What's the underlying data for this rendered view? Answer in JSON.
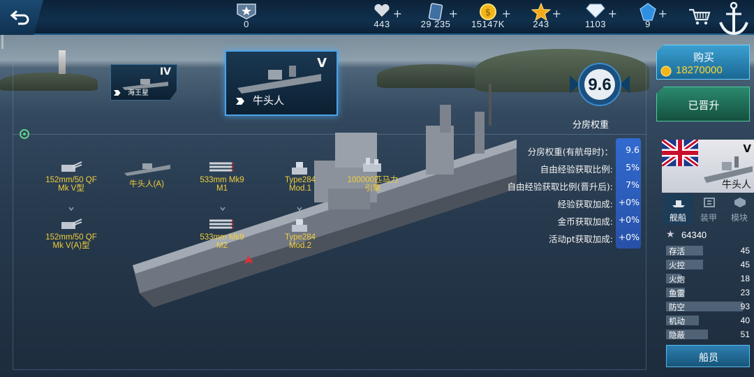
{
  "topbar": {
    "rank": {
      "icon": "rank-insignia-icon",
      "value": "0"
    },
    "resources": [
      {
        "name": "heart",
        "icon": "heart-icon",
        "value": "443"
      },
      {
        "name": "cards",
        "icon": "card-icon",
        "value": "29 235"
      },
      {
        "name": "gold",
        "icon": "gold-coin-icon",
        "value": "15147K"
      },
      {
        "name": "star",
        "icon": "star-icon",
        "value": "243"
      },
      {
        "name": "diamond",
        "icon": "diamond-icon",
        "value": "1103"
      },
      {
        "name": "gem",
        "icon": "blue-gem-icon",
        "value": "9"
      }
    ],
    "plus": "+"
  },
  "ship_cards": {
    "small": {
      "tier": "IV",
      "name": "海王星"
    },
    "selected": {
      "tier": "V",
      "name": "牛头人"
    }
  },
  "score": {
    "value": "9.6",
    "label": "分房权重"
  },
  "stats": [
    {
      "label": "分房权重(有航母时)：",
      "value": "9.6"
    },
    {
      "label": "自由经验获取比例:",
      "value": "5%"
    },
    {
      "label": "自由经验获取比例(晋升后):",
      "value": "7%"
    },
    {
      "label": "经验获取加成:",
      "value": "+0%"
    },
    {
      "label": "金币获取加成:",
      "value": "+0%"
    },
    {
      "label": "活动pt获取加成:",
      "value": "+0%"
    }
  ],
  "modules": {
    "gun_main": "152mm/50 QF\nMk V型",
    "hull_a": "牛头人(A)",
    "torp_1": "533mm Mk9\nM1",
    "radar_1": "Type284\nMod.1",
    "engine": "100000匹马力\n引擎",
    "gun_alt": "152mm/50 QF\nMk V(A)型",
    "torp_2": "533mm Mk9\nM2",
    "radar_2": "Type284\nMod.2"
  },
  "right_panel": {
    "buy_label": "购买",
    "price": "18270000",
    "promoted_label": "已晋升",
    "ship_tier": "V",
    "ship_name": "牛头人",
    "tabs": [
      "舰船",
      "装甲",
      "模块"
    ],
    "power": "64340",
    "attributes": [
      {
        "label": "存活",
        "value": "45"
      },
      {
        "label": "火控",
        "value": "45"
      },
      {
        "label": "火炮",
        "value": "18"
      },
      {
        "label": "鱼雷",
        "value": "23"
      },
      {
        "label": "防空",
        "value": "93"
      },
      {
        "label": "机动",
        "value": "40"
      },
      {
        "label": "隐蔽",
        "value": "51"
      }
    ],
    "crew_label": "船员"
  },
  "colors": {
    "accent": "#4aa3e8",
    "module_text": "#f2cf3c",
    "price": "#ffd42a",
    "stats_highlight": "#2f64d2"
  }
}
